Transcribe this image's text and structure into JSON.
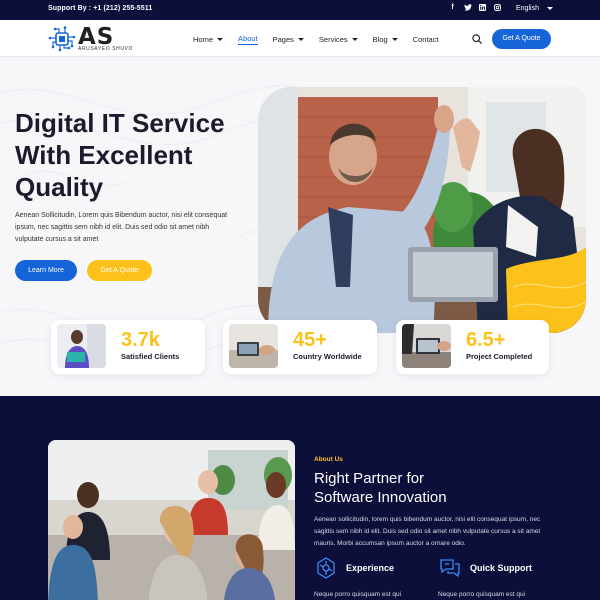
{
  "topbar": {
    "support": "Support By : +1 (212) 255-5511",
    "socials": [
      "facebook-icon",
      "twitter-icon",
      "linkedin-icon",
      "instagram-icon"
    ],
    "language": "English"
  },
  "header": {
    "logo_text": "AS",
    "logo_sub": "ARUSAYEO SHUVO",
    "nav": [
      {
        "label": "Home",
        "dropdown": true
      },
      {
        "label": "About",
        "dropdown": false,
        "active": true
      },
      {
        "label": "Pages",
        "dropdown": true
      },
      {
        "label": "Services",
        "dropdown": true
      },
      {
        "label": "Blog",
        "dropdown": true
      },
      {
        "label": "Contact",
        "dropdown": false
      }
    ],
    "cta": "Get A Quote"
  },
  "hero": {
    "title_lines": [
      "Digital IT Service",
      "With Excellent",
      "Quality"
    ],
    "text": "Aenean Sollicitudin, Lorem quis Bibendum auctor, nisi elit consequat ipsum, nec sagittis sem nibh id elit. Duis sed odio sit amet nibh vulputate cursus a sit amet",
    "btn_learn": "Learn More",
    "btn_quote": "Get A Quote",
    "stats": [
      {
        "value": "3.7k",
        "label": "Satisfied Clients"
      },
      {
        "value": "45+",
        "label": "Country Worldwide"
      },
      {
        "value": "6.5+",
        "label": "Project Completed"
      }
    ]
  },
  "about": {
    "kicker": "About Us",
    "title_lines": [
      "Right Partner for",
      "Software Innovation"
    ],
    "text": "Aenean sollicitudin, lorem quis bibendum auctor, nisi elit consequat ipsum, nec sagittis sem nibh id elit. Duis sed odio sit amet nibh vulputate cursus a sit amet mauris. Morbi accumsan ipsum auctor a ornare odio.",
    "features": [
      {
        "name": "Experience",
        "desc": "Neque porro quisquam est qui"
      },
      {
        "name": "Quick Support",
        "desc": "Neque porro quisquam est qui"
      }
    ]
  },
  "colors": {
    "primary": "#1565d8",
    "accent": "#fcc11a",
    "dark": "#0c0f3a"
  }
}
